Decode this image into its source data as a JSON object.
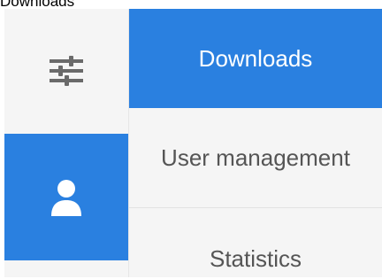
{
  "page_label": "Downloads",
  "rail": {
    "items": [
      {
        "icon": "sliders-icon",
        "active": false
      },
      {
        "icon": "user-icon",
        "active": true
      }
    ]
  },
  "menu": {
    "items": [
      {
        "label": "Downloads",
        "active": true
      },
      {
        "label": "User management",
        "active": false
      },
      {
        "label": "Statistics",
        "active": false
      }
    ]
  },
  "colors": {
    "accent": "#2a80e0",
    "panel_bg": "#f5f5f5",
    "menu_text": "#555555",
    "icon_gray": "#6a6a6a"
  }
}
